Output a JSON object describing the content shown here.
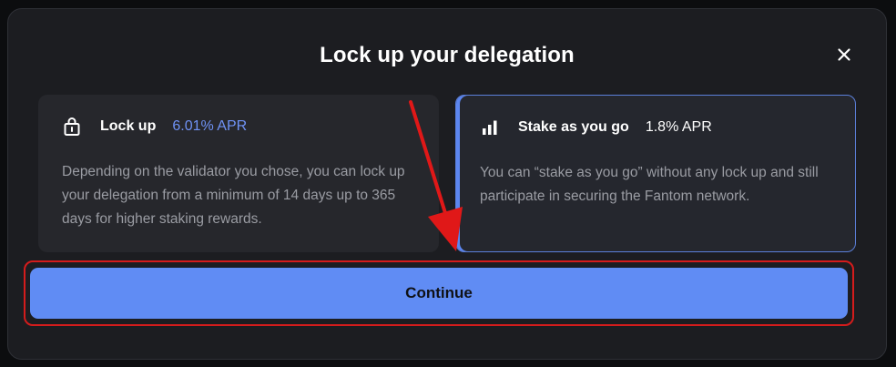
{
  "modal": {
    "title": "Lock up your delegation",
    "close_icon": "close-icon"
  },
  "options": {
    "lockup": {
      "name": "Lock up",
      "apr": "6.01% APR",
      "description": "Depending on the validator you chose, you can lock up your delegation from a minimum of 14 days up to 365 days for higher staking rewards.",
      "icon": "lock-icon",
      "selected": false
    },
    "stake": {
      "name": "Stake as you go",
      "apr": "1.8% APR",
      "description": "You can “stake as you go” without any lock up and still participate in securing the Fantom network.",
      "icon": "bar-chart-icon",
      "selected": true
    }
  },
  "actions": {
    "continue_label": "Continue"
  },
  "colors": {
    "accent": "#608cf4",
    "selected_border": "#5b7fd9",
    "annotation": "#d41c1c",
    "modal_bg": "#1c1d21",
    "card_bg": "#26272c"
  }
}
